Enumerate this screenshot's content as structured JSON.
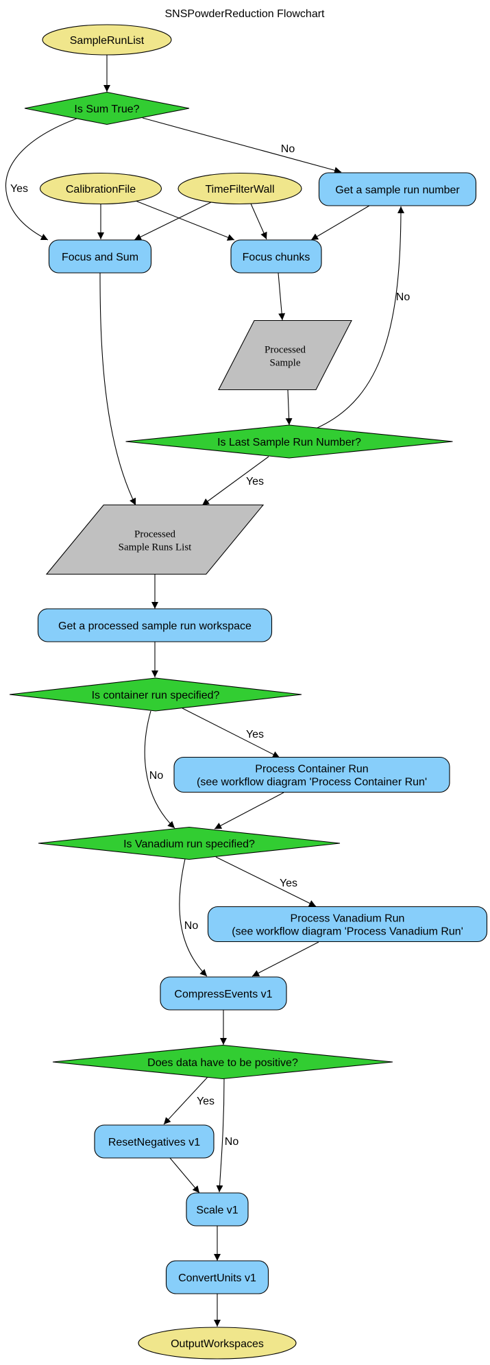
{
  "title": "SNSPowderReduction Flowchart",
  "colors": {
    "input": "#f0e68c",
    "process": "#87cefa",
    "decision": "#32cd32",
    "data": "#c0c0c0",
    "stroke": "#000000"
  },
  "nodes": [
    {
      "id": "SampleRunList",
      "type": "input",
      "lines": [
        "SampleRunList"
      ]
    },
    {
      "id": "IsSumTrue",
      "type": "decision",
      "lines": [
        "Is Sum True?"
      ]
    },
    {
      "id": "CalibrationFile",
      "type": "input",
      "lines": [
        "CalibrationFile"
      ]
    },
    {
      "id": "TimeFilterWall",
      "type": "input",
      "lines": [
        "TimeFilterWall"
      ]
    },
    {
      "id": "GetSampleRunNumber",
      "type": "process",
      "lines": [
        "Get a sample run number"
      ]
    },
    {
      "id": "FocusAndSum",
      "type": "process",
      "lines": [
        "Focus and Sum"
      ]
    },
    {
      "id": "FocusChunks",
      "type": "process",
      "lines": [
        "Focus chunks"
      ]
    },
    {
      "id": "ProcessedSample",
      "type": "data",
      "lines": [
        "Processed",
        "Sample"
      ]
    },
    {
      "id": "IsLastSampleRun",
      "type": "decision",
      "lines": [
        "Is Last Sample Run Number?"
      ]
    },
    {
      "id": "ProcessedSampleRunsList",
      "type": "data",
      "lines": [
        "Processed",
        "Sample Runs List"
      ]
    },
    {
      "id": "GetProcessedWorkspace",
      "type": "process",
      "lines": [
        "Get a processed sample run workspace"
      ]
    },
    {
      "id": "IsContainerSpecified",
      "type": "decision",
      "lines": [
        "Is container run specified?"
      ]
    },
    {
      "id": "ProcessContainerRun",
      "type": "process",
      "lines": [
        "Process Container Run",
        "(see workflow diagram 'Process Container Run'"
      ]
    },
    {
      "id": "IsVanadiumSpecified",
      "type": "decision",
      "lines": [
        "Is Vanadium run specified?"
      ]
    },
    {
      "id": "ProcessVanadiumRun",
      "type": "process",
      "lines": [
        "Process Vanadium Run",
        "(see workflow diagram 'Process Vanadium Run'"
      ]
    },
    {
      "id": "CompressEvents",
      "type": "process",
      "lines": [
        "CompressEvents v1"
      ]
    },
    {
      "id": "IsPositive",
      "type": "decision",
      "lines": [
        "Does data have to be positive?"
      ]
    },
    {
      "id": "ResetNegatives",
      "type": "process",
      "lines": [
        "ResetNegatives v1"
      ]
    },
    {
      "id": "Scale",
      "type": "process",
      "lines": [
        "Scale v1"
      ]
    },
    {
      "id": "ConvertUnits",
      "type": "process",
      "lines": [
        "ConvertUnits v1"
      ]
    },
    {
      "id": "OutputWorkspaces",
      "type": "input",
      "lines": [
        "OutputWorkspaces"
      ]
    }
  ],
  "edges": [
    {
      "from": "SampleRunList",
      "to": "IsSumTrue",
      "label": ""
    },
    {
      "from": "IsSumTrue",
      "to": "FocusAndSum",
      "label": "Yes"
    },
    {
      "from": "IsSumTrue",
      "to": "GetSampleRunNumber",
      "label": "No"
    },
    {
      "from": "CalibrationFile",
      "to": "FocusAndSum",
      "label": ""
    },
    {
      "from": "CalibrationFile",
      "to": "FocusChunks",
      "label": ""
    },
    {
      "from": "TimeFilterWall",
      "to": "FocusAndSum",
      "label": ""
    },
    {
      "from": "TimeFilterWall",
      "to": "FocusChunks",
      "label": ""
    },
    {
      "from": "GetSampleRunNumber",
      "to": "FocusChunks",
      "label": ""
    },
    {
      "from": "FocusChunks",
      "to": "ProcessedSample",
      "label": ""
    },
    {
      "from": "ProcessedSample",
      "to": "IsLastSampleRun",
      "label": ""
    },
    {
      "from": "IsLastSampleRun",
      "to": "GetSampleRunNumber",
      "label": "No"
    },
    {
      "from": "IsLastSampleRun",
      "to": "ProcessedSampleRunsList",
      "label": "Yes"
    },
    {
      "from": "FocusAndSum",
      "to": "ProcessedSampleRunsList",
      "label": ""
    },
    {
      "from": "ProcessedSampleRunsList",
      "to": "GetProcessedWorkspace",
      "label": ""
    },
    {
      "from": "GetProcessedWorkspace",
      "to": "IsContainerSpecified",
      "label": ""
    },
    {
      "from": "IsContainerSpecified",
      "to": "ProcessContainerRun",
      "label": "Yes"
    },
    {
      "from": "IsContainerSpecified",
      "to": "IsVanadiumSpecified",
      "label": "No"
    },
    {
      "from": "ProcessContainerRun",
      "to": "IsVanadiumSpecified",
      "label": ""
    },
    {
      "from": "IsVanadiumSpecified",
      "to": "ProcessVanadiumRun",
      "label": "Yes"
    },
    {
      "from": "IsVanadiumSpecified",
      "to": "CompressEvents",
      "label": "No"
    },
    {
      "from": "ProcessVanadiumRun",
      "to": "CompressEvents",
      "label": ""
    },
    {
      "from": "CompressEvents",
      "to": "IsPositive",
      "label": ""
    },
    {
      "from": "IsPositive",
      "to": "ResetNegatives",
      "label": "Yes"
    },
    {
      "from": "IsPositive",
      "to": "Scale",
      "label": "No"
    },
    {
      "from": "ResetNegatives",
      "to": "Scale",
      "label": ""
    },
    {
      "from": "Scale",
      "to": "ConvertUnits",
      "label": ""
    },
    {
      "from": "ConvertUnits",
      "to": "OutputWorkspaces",
      "label": ""
    }
  ]
}
